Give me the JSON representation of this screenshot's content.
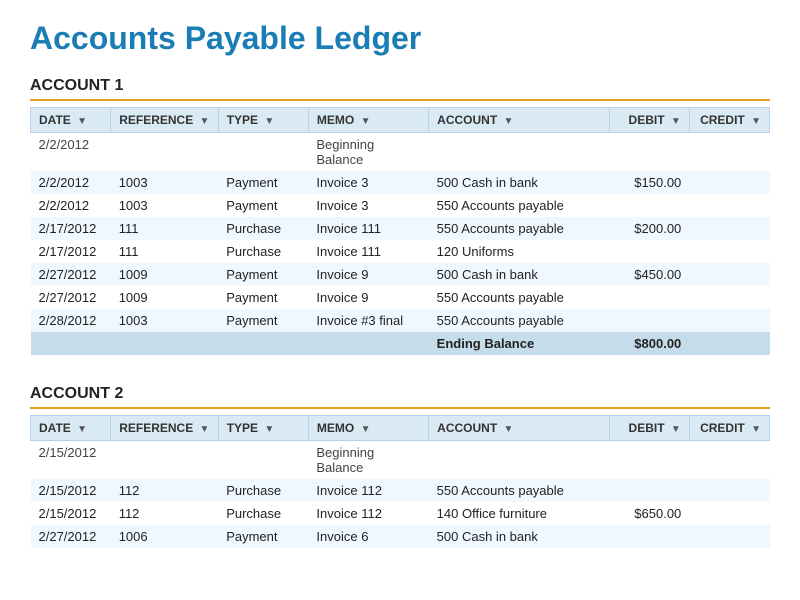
{
  "page": {
    "title": "Accounts Payable Ledger"
  },
  "accounts": [
    {
      "heading": "ACCOUNT 1",
      "columns": [
        "DATE",
        "REFERENCE",
        "TYPE",
        "MEMO",
        "ACCOUNT",
        "DEBIT",
        "CREDIT"
      ],
      "rows": [
        {
          "date": "2/2/2012",
          "reference": "",
          "type": "",
          "memo": "Beginning Balance",
          "account": "",
          "debit": "",
          "credit": ""
        },
        {
          "date": "2/2/2012",
          "reference": "1003",
          "type": "Payment",
          "memo": "Invoice 3",
          "account": "500 Cash in bank",
          "debit": "$150.00",
          "credit": ""
        },
        {
          "date": "2/2/2012",
          "reference": "1003",
          "type": "Payment",
          "memo": "Invoice 3",
          "account": "550 Accounts payable",
          "debit": "",
          "credit": ""
        },
        {
          "date": "2/17/2012",
          "reference": "111",
          "type": "Purchase",
          "memo": "Invoice 111",
          "account": "550 Accounts payable",
          "debit": "$200.00",
          "credit": ""
        },
        {
          "date": "2/17/2012",
          "reference": "111",
          "type": "Purchase",
          "memo": "Invoice 111",
          "account": "120 Uniforms",
          "debit": "",
          "credit": ""
        },
        {
          "date": "2/27/2012",
          "reference": "1009",
          "type": "Payment",
          "memo": "Invoice 9",
          "account": "500 Cash in bank",
          "debit": "$450.00",
          "credit": ""
        },
        {
          "date": "2/27/2012",
          "reference": "1009",
          "type": "Payment",
          "memo": "Invoice 9",
          "account": "550 Accounts payable",
          "debit": "",
          "credit": ""
        },
        {
          "date": "2/28/2012",
          "reference": "1003",
          "type": "Payment",
          "memo": "Invoice #3 final",
          "account": "550 Accounts payable",
          "debit": "",
          "credit": ""
        }
      ],
      "ending_balance": {
        "label": "Ending Balance",
        "debit": "$800.00",
        "credit": ""
      }
    },
    {
      "heading": "ACCOUNT 2",
      "columns": [
        "DATE",
        "REFERENCE",
        "TYPE",
        "MEMO",
        "ACCOUNT",
        "DEBIT",
        "CREDIT"
      ],
      "rows": [
        {
          "date": "2/15/2012",
          "reference": "",
          "type": "",
          "memo": "Beginning Balance",
          "account": "",
          "debit": "",
          "credit": ""
        },
        {
          "date": "2/15/2012",
          "reference": "112",
          "type": "Purchase",
          "memo": "Invoice 112",
          "account": "550 Accounts payable",
          "debit": "",
          "credit": ""
        },
        {
          "date": "2/15/2012",
          "reference": "112",
          "type": "Purchase",
          "memo": "Invoice 112",
          "account": "140 Office furniture",
          "debit": "$650.00",
          "credit": ""
        },
        {
          "date": "2/27/2012",
          "reference": "1006",
          "type": "Payment",
          "memo": "Invoice 6",
          "account": "500 Cash in bank",
          "debit": "",
          "credit": ""
        }
      ],
      "ending_balance": null
    }
  ]
}
